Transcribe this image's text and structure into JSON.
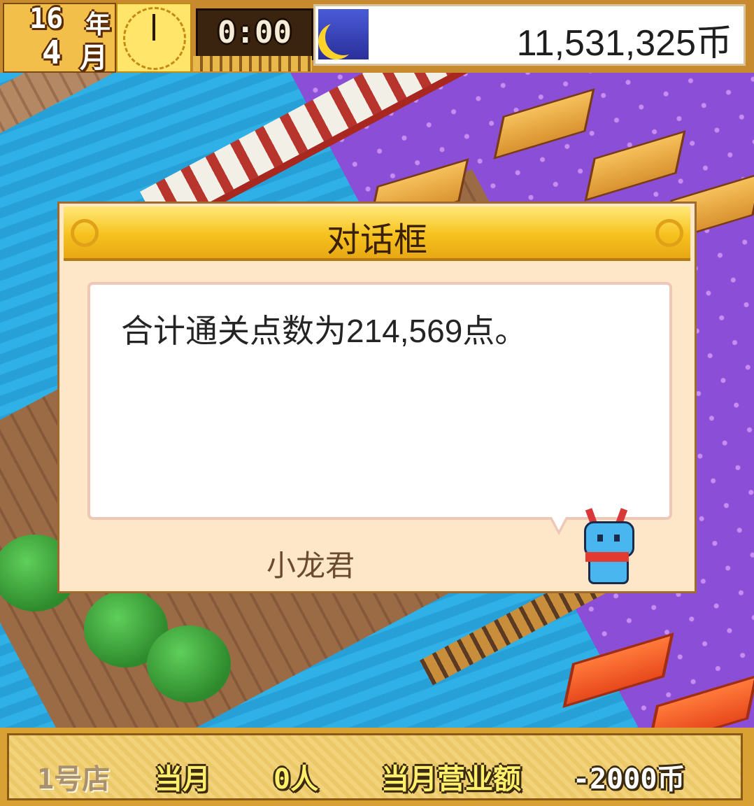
{
  "hud": {
    "year_number": "16",
    "year_label": "年",
    "month_number": "4",
    "month_label": "月",
    "time": "0:00",
    "money": "11,531,325币",
    "icon": "moon-icon",
    "clock_icon": "clock-icon"
  },
  "dialog": {
    "title": "对话框",
    "message": "合计通关点数为214,569点。",
    "speaker": "小龙君",
    "avatar": "dragon-mascot"
  },
  "status_bar": {
    "store": "1号店",
    "month": "当月",
    "visitors": "0人",
    "revenue_label": "当月营业额",
    "revenue": "-2000币"
  }
}
